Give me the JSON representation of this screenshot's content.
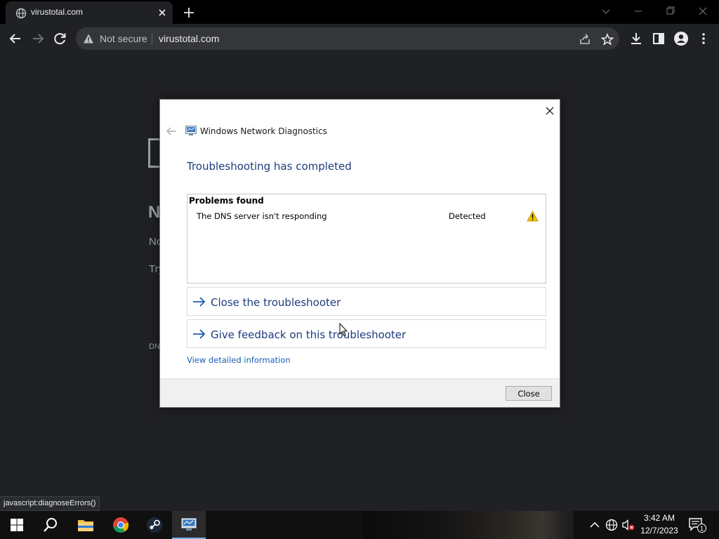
{
  "browser": {
    "tab": {
      "title": "virustotal.com"
    },
    "omnibox": {
      "security_label": "Not secure",
      "url": "virustotal.com"
    }
  },
  "page": {
    "heading_fragment": "N",
    "line1_fragment": "No",
    "line2_fragment": "Try",
    "code_fragment": "DN"
  },
  "status_bar": {
    "text": "javascript:diagnoseErrors()"
  },
  "dialog": {
    "app_title": "Windows Network Diagnostics",
    "heading": "Troubleshooting has completed",
    "problems": {
      "title": "Problems found",
      "items": [
        {
          "name": "The DNS server isn't responding",
          "status": "Detected"
        }
      ]
    },
    "actions": [
      {
        "label": "Close the troubleshooter"
      },
      {
        "label": "Give feedback on this troubleshooter"
      }
    ],
    "detail_link": "View detailed information",
    "close_button": "Close"
  },
  "taskbar": {
    "clock": {
      "time": "3:42 AM",
      "date": "12/7/2023"
    },
    "notification_count": "1"
  },
  "colors": {
    "chrome_bg": "#202124",
    "dialog_heading": "#1c3c7c",
    "link": "#1a5fb4",
    "warning": "#f5c400"
  }
}
